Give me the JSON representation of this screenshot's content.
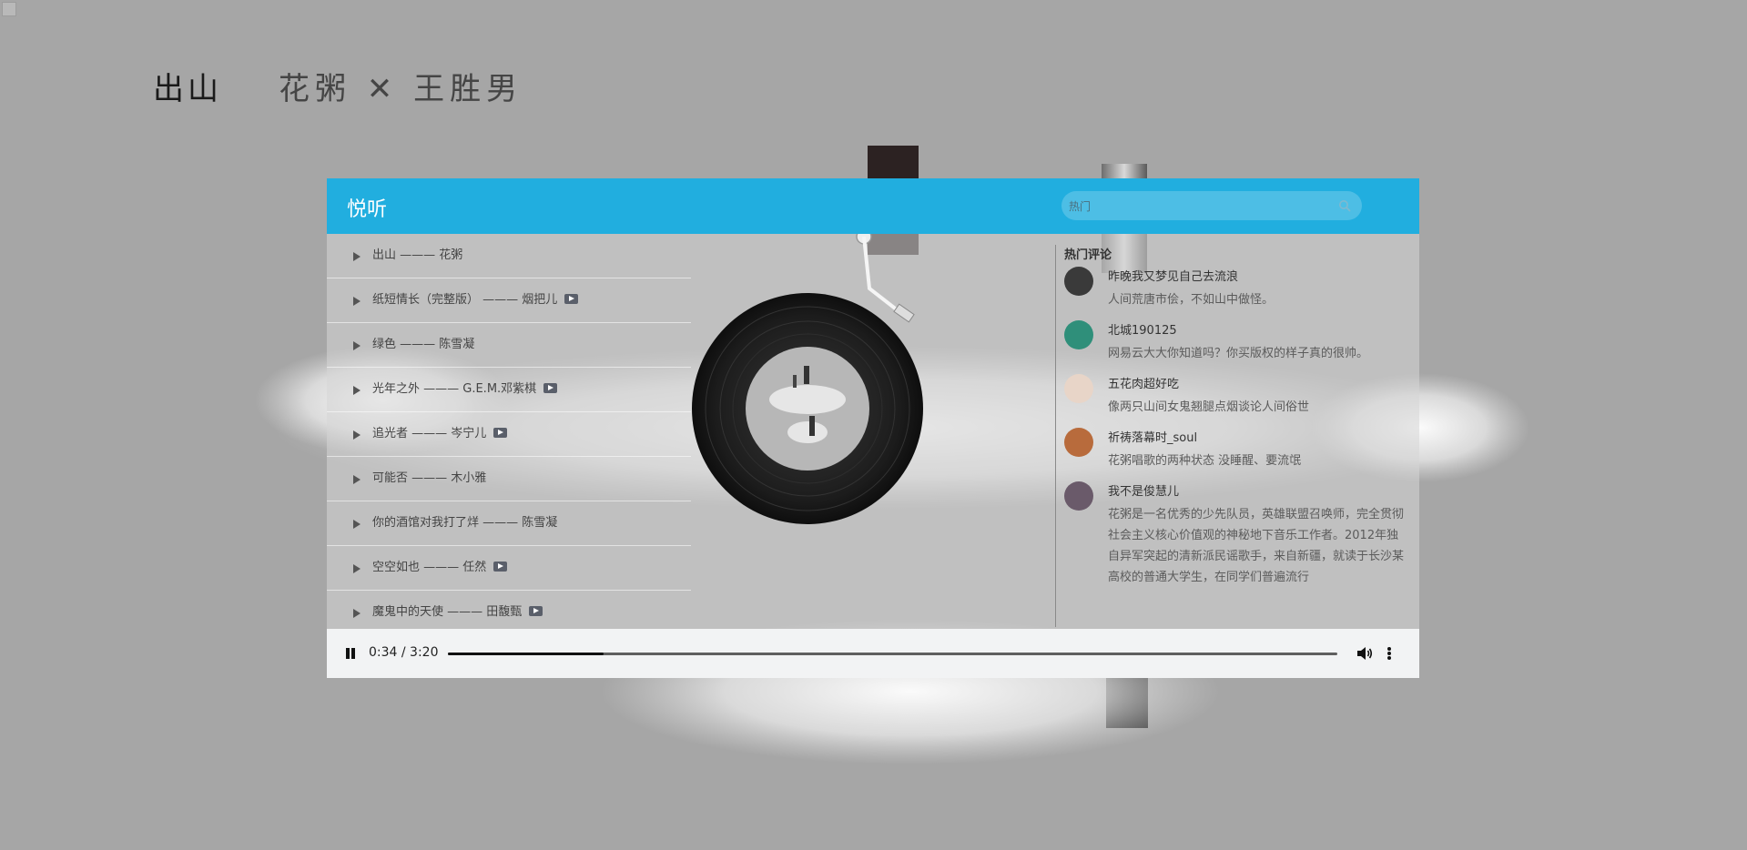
{
  "page": {
    "song_title": "出山",
    "song_artists": "花粥 ✕ 王胜男"
  },
  "header": {
    "app_title": "悦听",
    "search": {
      "value": "",
      "placeholder": "热门"
    }
  },
  "playlist": [
    {
      "label": "出山 ——— 花粥",
      "has_mv": false
    },
    {
      "label": "纸短情长（完整版） ——— 烟把儿",
      "has_mv": true
    },
    {
      "label": "绿色 ——— 陈雪凝",
      "has_mv": false
    },
    {
      "label": "光年之外 ——— G.E.M.邓紫棋",
      "has_mv": true
    },
    {
      "label": "追光者 ——— 岑宁儿",
      "has_mv": true
    },
    {
      "label": "可能否 ——— 木小雅",
      "has_mv": false
    },
    {
      "label": "你的酒馆对我打了烊 ——— 陈雪凝",
      "has_mv": false
    },
    {
      "label": "空空如也 ——— 任然",
      "has_mv": true
    },
    {
      "label": "魔鬼中的天使 ——— 田馥甄",
      "has_mv": true
    }
  ],
  "comments": {
    "title": "热门评论",
    "items": [
      {
        "user": "昨晚我又梦见自己去流浪",
        "text": "人间荒唐市侩，不如山中做怪。",
        "avatar_color": "#3a3a3a"
      },
      {
        "user": "北城190125",
        "text": "网易云大大你知道吗？你买版权的样子真的很帅。",
        "avatar_color": "#2f8f7a"
      },
      {
        "user": "五花肉超好吃",
        "text": "像两只山间女鬼翘腿点烟谈论人间俗世",
        "avatar_color": "#e8d5c8"
      },
      {
        "user": "祈祷落幕时_soul",
        "text": "花粥唱歌的两种状态 没睡醒、要流氓",
        "avatar_color": "#b86b3c"
      },
      {
        "user": "我不是俊慧儿",
        "text": "花粥是一名优秀的少先队员，英雄联盟召唤师，完全贯彻社会主义核心价值观的神秘地下音乐工作者。2012年独自异军突起的清新派民谣歌手，来自新疆，就读于长沙某高校的普通大学生，在同学们普遍流行",
        "avatar_color": "#6a5a6a"
      }
    ]
  },
  "player": {
    "time_display": "0:34 / 3:20",
    "progress": 0.175
  }
}
